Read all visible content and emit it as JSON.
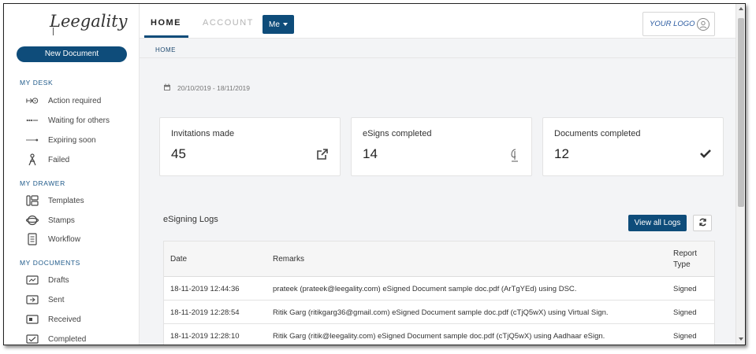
{
  "brand": {
    "logo_text": "Leegality"
  },
  "sidebar": {
    "new_document": "New Document",
    "sections": {
      "my_desk": "MY DESK",
      "my_drawer": "MY DRAWER",
      "my_documents": "MY DOCUMENTS"
    },
    "my_desk_items": [
      {
        "label": "Action required",
        "icon": "action-required-icon"
      },
      {
        "label": "Waiting for others",
        "icon": "waiting-icon"
      },
      {
        "label": "Expiring soon",
        "icon": "expiring-icon"
      },
      {
        "label": "Failed",
        "icon": "failed-icon"
      }
    ],
    "my_drawer_items": [
      {
        "label": "Templates",
        "icon": "templates-icon"
      },
      {
        "label": "Stamps",
        "icon": "stamps-icon"
      },
      {
        "label": "Workflow",
        "icon": "workflow-icon"
      }
    ],
    "my_documents_items": [
      {
        "label": "Drafts",
        "icon": "drafts-icon"
      },
      {
        "label": "Sent",
        "icon": "sent-icon"
      },
      {
        "label": "Received",
        "icon": "received-icon"
      },
      {
        "label": "Completed",
        "icon": "completed-icon"
      }
    ]
  },
  "topbar": {
    "tabs": [
      "HOME",
      "ACCOUNT"
    ],
    "me_label": "Me",
    "your_logo": "YOUR LOGO"
  },
  "main": {
    "breadcrumb": "HOME",
    "date_range": "20/10/2019 - 18/11/2019",
    "cards": [
      {
        "title": "Invitations made",
        "value": "45",
        "icon": "external-link-icon"
      },
      {
        "title": "eSigns completed",
        "value": "14",
        "icon": "esign-pen-icon"
      },
      {
        "title": "Documents completed",
        "value": "12",
        "icon": "checkmark-icon"
      }
    ],
    "logs": {
      "title": "eSigning Logs",
      "view_all": "View all Logs",
      "columns": [
        "Date",
        "Remarks",
        "Report Type"
      ],
      "rows": [
        {
          "date": "18-11-2019 12:44:36",
          "remarks": "prateek (prateek@leegality.com) eSigned Document sample doc.pdf (ArTgYEd) using DSC.",
          "type": "Signed"
        },
        {
          "date": "18-11-2019 12:28:54",
          "remarks": "Ritik Garg (ritikgarg36@gmail.com) eSigned Document sample doc.pdf (cTjQ5wX) using Virtual Sign.",
          "type": "Signed"
        },
        {
          "date": "18-11-2019 12:28:10",
          "remarks": "Ritik Garg (ritik@leegality.com) eSigned Document sample doc.pdf (cTjQ5wX) using Aadhaar eSign.",
          "type": "Signed"
        }
      ]
    }
  },
  "colors": {
    "primary": "#0e4c7a",
    "accent_text": "#1f5a8a",
    "background": "#f3f4f6"
  }
}
